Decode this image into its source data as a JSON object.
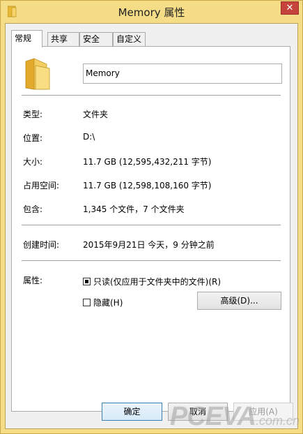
{
  "window": {
    "title": "Memory 属性",
    "close_glyph": "✕"
  },
  "tabs": [
    {
      "label": "常规",
      "active": true
    },
    {
      "label": "共享",
      "active": false
    },
    {
      "label": "安全",
      "active": false
    },
    {
      "label": "自定义",
      "active": false
    }
  ],
  "general": {
    "folder_name": "Memory",
    "type_label": "类型:",
    "type_value": "文件夹",
    "location_label": "位置:",
    "location_value": "D:\\",
    "size_label": "大小:",
    "size_value": "11.7 GB (12,595,432,211 字节)",
    "size_on_disk_label": "占用空间:",
    "size_on_disk_value": "11.7 GB (12,598,108,160 字节)",
    "contains_label": "包含:",
    "contains_value": "1,345 个文件，7 个文件夹",
    "created_label": "创建时间:",
    "created_value": "2015年9月21日 今天，9 分钟之前",
    "attributes_label": "属性:",
    "readonly_label": "只读(仅应用于文件夹中的文件)(R)",
    "readonly_state": "indeterminate",
    "hidden_label": "隐藏(H)",
    "hidden_checked": false,
    "advanced_button": "高级(D)..."
  },
  "footer": {
    "ok": "确定",
    "cancel": "取消",
    "apply": "应用(A)"
  },
  "watermark": {
    "main": "PCEVA",
    "suffix": ".com.cn"
  },
  "colors": {
    "title_bar": "#f5dc86",
    "close_button": "#c6443c",
    "default_button_border": "#3c7fb1"
  }
}
